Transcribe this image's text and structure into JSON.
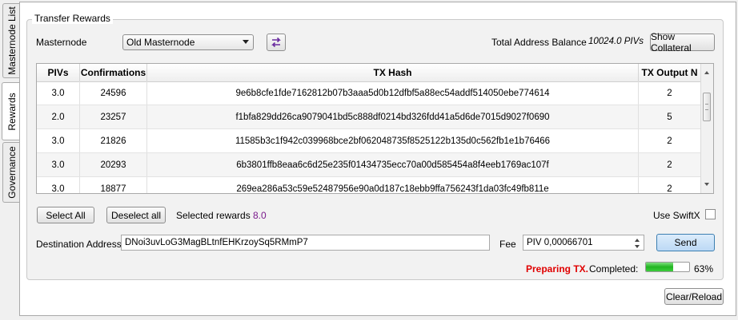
{
  "tabs": {
    "masternode_list": "Masternode List",
    "rewards": "Rewards",
    "governance": "Governance"
  },
  "group_title": "Transfer Rewards",
  "masternode": {
    "label": "Masternode",
    "selected": "Old Masternode",
    "refresh_icon": "swap-arrows-icon"
  },
  "balance": {
    "label": "Total Address Balance",
    "value": "10024.0 PIVs"
  },
  "show_collateral_label": "Show Collateral",
  "table": {
    "headers": [
      "PIVs",
      "Confirmations",
      "TX Hash",
      "TX Output N"
    ],
    "rows": [
      [
        "3.0",
        "24596",
        "9e6b8cfe1fde7162812b07b3aaa5d0b12dfbf5a88ec54addf514050ebe774614",
        "2"
      ],
      [
        "2.0",
        "23257",
        "f1bfa829dd26ca9079041bd5c888df0214bd326fdd41a5d6de7015d9027f0690",
        "5"
      ],
      [
        "3.0",
        "21826",
        "11585b3c1f942c039968bce2bf062048735f8525122b135d0c562fb1e1b76466",
        "2"
      ],
      [
        "3.0",
        "20293",
        "6b3801ffb8eaa6c6d25e235f01434735ecc70a00d585454a8f4eeb1769ac107f",
        "2"
      ],
      [
        "3.0",
        "18877",
        "269ea286a53c59e52487956e90a0d187c18ebb9ffa756243f1da03fc49fb811e",
        "2"
      ]
    ]
  },
  "select_all_label": "Select All",
  "deselect_all_label": "Deselect all",
  "selected_rewards": {
    "label": "Selected rewards",
    "value": "8.0",
    "color": "#7a1a8c"
  },
  "use_swiftx_label": "Use SwiftX",
  "destination": {
    "label": "Destination Address",
    "value": "DNoi3uvLoG3MagBLtnfEHKrzoySq5RMmP7"
  },
  "fee": {
    "label": "Fee",
    "value": "PIV 0,00066701"
  },
  "send_label": "Send",
  "status": {
    "preparing": "Preparing TX.",
    "preparing_color": "#e00000",
    "completed_label": "Completed:",
    "progress_percent": 63,
    "progress_text": "63%"
  },
  "clear_reload_label": "Clear/Reload"
}
